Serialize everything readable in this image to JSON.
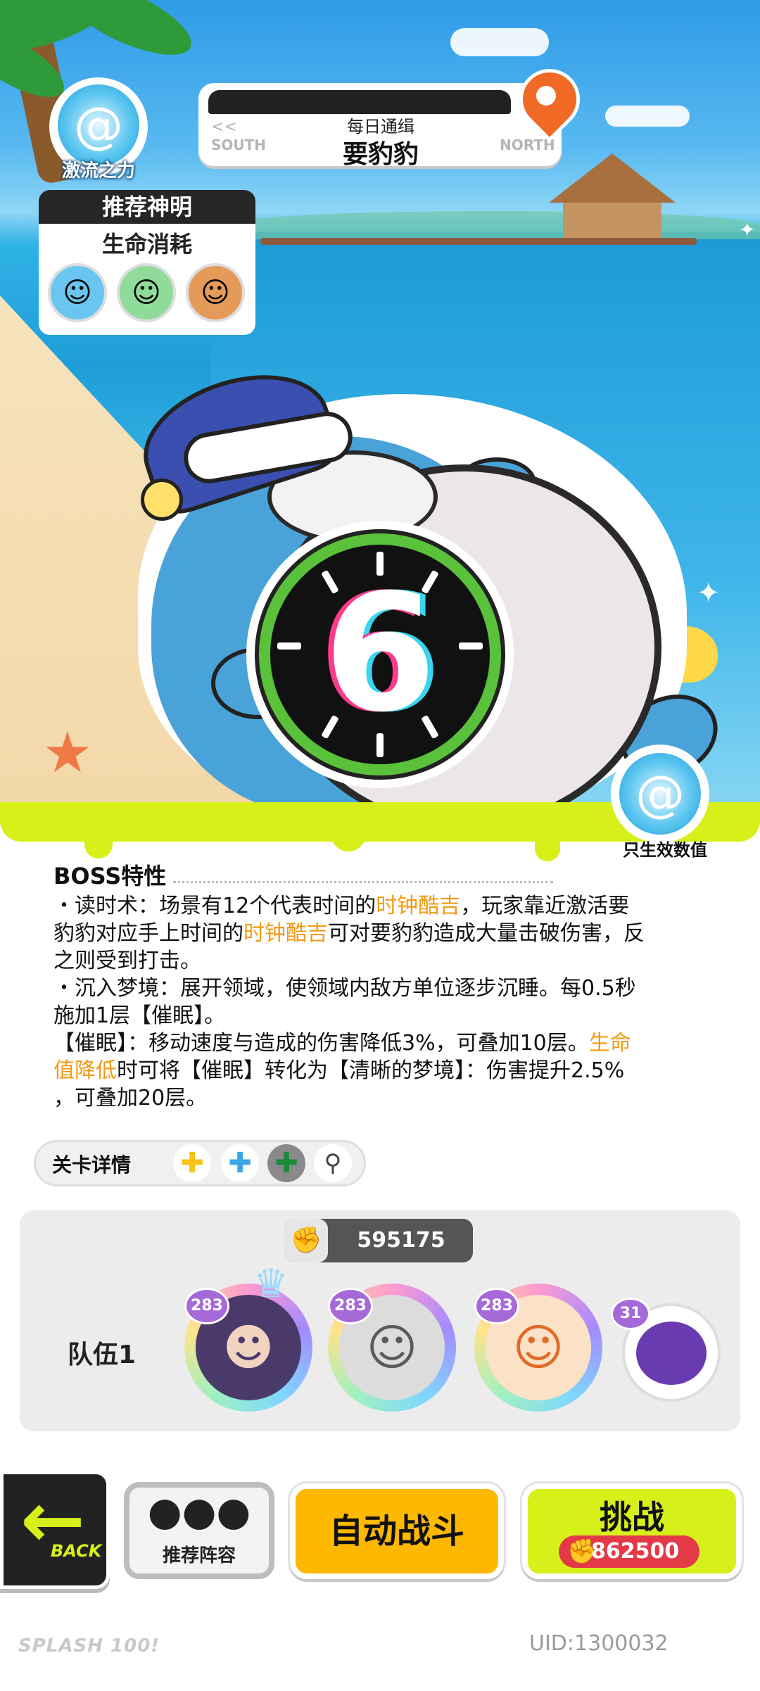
{
  "element": {
    "icon": "water-swirl-icon",
    "label": "激流之力"
  },
  "wanted": {
    "subtitle": "每日通缉",
    "boss_name": "要豹豹",
    "south": "SOUTH",
    "north": "NORTH",
    "arrow": "<<",
    "pin_icon": "map-pin-icon"
  },
  "recommend": {
    "title": "推荐神明",
    "subtitle": "生命消耗",
    "avatars": [
      "blue-hair-god-avatar",
      "green-hair-god-avatar",
      "brown-hair-god-avatar"
    ]
  },
  "boss": {
    "clock_number": "6"
  },
  "stat_badge": {
    "icon": "water-swirl-icon",
    "label": "只生效数值"
  },
  "traits": {
    "title": "BOSS特性",
    "p1": {
      "a": "・读时术：场景有12个代表时间的",
      "hl1": "时钟酷吉",
      "b": "，玩家靠近激活要",
      "c": "豹豹对应手上时间的",
      "hl2": "时钟酷吉",
      "d": "可对要豹豹造成大量击破伤害，反",
      "e": "之则受到打击。"
    },
    "p2": {
      "a": "・沉入梦境：展开领域，使领域内敌方单位逐步沉睡。每0.5秒",
      "b": "施加1层【催眠】。"
    },
    "p3": {
      "a": "【催眠】：移动速度与造成的伤害降低3%，可叠加10层。",
      "hl1": "生命",
      "hl2": "值降低",
      "b": "时可将【催眠】转化为【清晰的梦境】：伤害提升2.5%",
      "c": "，可叠加20层。"
    }
  },
  "stage": {
    "label": "关卡详情",
    "icons": [
      "yellow-clover-icon",
      "blue-clover-icon",
      "green-clover-icon",
      "magnifier-icon"
    ]
  },
  "team": {
    "label": "队伍1",
    "power": "595175",
    "heroes": [
      {
        "level": "283",
        "name": "dark-hair-hero"
      },
      {
        "level": "283",
        "name": "silver-hair-hero"
      },
      {
        "level": "283",
        "name": "orange-hair-hero"
      }
    ],
    "pet_level": "31"
  },
  "buttons": {
    "back": "BACK",
    "recommend_lineup": "推荐阵容",
    "auto_battle": "自动战斗",
    "challenge": "挑战",
    "challenge_cost": "862500"
  },
  "footer": {
    "logo": "SPLASH 100!",
    "uid": "UID:1300032"
  },
  "colors": {
    "highlight": "#f29a12",
    "slime": "#d8f01a",
    "auto": "#ffb800",
    "cost": "#e43a48"
  }
}
